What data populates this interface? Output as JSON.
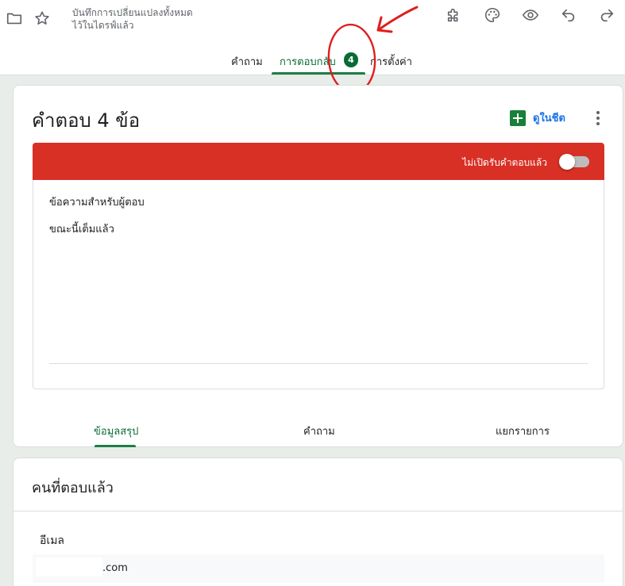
{
  "header": {
    "save_status_line1": "บันทึกการเปลี่ยนแปลงทั้งหมด",
    "save_status_line2": "ไว้ในไดรฟ์แล้ว",
    "tabs": [
      {
        "label": "คำถาม",
        "active": false
      },
      {
        "label": "การตอบกลับ",
        "active": true,
        "badge": "4"
      },
      {
        "label": "การตั้งค่า",
        "active": false
      }
    ],
    "icons": [
      "folder-icon",
      "star-icon",
      "addon-icon",
      "palette-icon",
      "preview-eye-icon",
      "undo-icon",
      "redo-icon"
    ]
  },
  "responses": {
    "title": "คำตอบ 4 ข้อ",
    "sheet_link_label": "ดูในชีต",
    "accepting_status": "ไม่เปิดรับคำตอบแล้ว",
    "accepting_toggle_on": false,
    "message_label": "ข้อความสำหรับผู้ตอบ",
    "message_text": "ขณะนี้เต็มแล้ว",
    "sub_tabs": [
      {
        "label": "ข้อมูลสรุป",
        "active": true
      },
      {
        "label": "คำถาม",
        "active": false
      },
      {
        "label": "แยกรายการ",
        "active": false
      }
    ]
  },
  "respondents": {
    "title": "คนที่ตอบแล้ว",
    "field_label": "อีเมล",
    "email_suffix": ".com"
  },
  "colors": {
    "accent_green": "#0b6b34",
    "banner_red": "#d93025",
    "link_blue": "#1a73e8",
    "annotation_red": "#e01e1e"
  }
}
